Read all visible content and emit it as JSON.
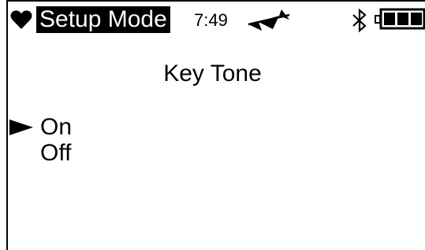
{
  "status_bar": {
    "mode_title": "Setup Mode",
    "time": "7:49",
    "icons": {
      "status": "heart-icon",
      "signal": "signal-icon",
      "bluetooth": "bluetooth-icon",
      "battery": "battery-icon"
    },
    "battery_level": 1.0
  },
  "page": {
    "title": "Key Tone",
    "options": [
      {
        "label": "On",
        "selected": true
      },
      {
        "label": "Off",
        "selected": false
      }
    ],
    "selection_icon": "pointer-arrow-icon"
  },
  "colors": {
    "foreground": "#000000",
    "background": "#ffffff"
  }
}
